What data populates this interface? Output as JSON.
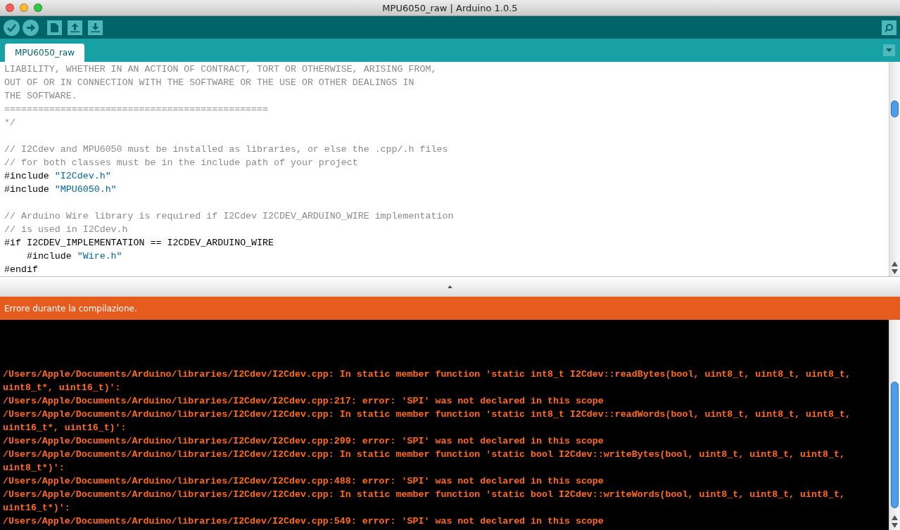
{
  "window": {
    "title": "MPU6050_raw | Arduino 1.0.5"
  },
  "tabs": [
    {
      "label": "MPU6050_raw",
      "selected": true
    }
  ],
  "editor": {
    "lines": [
      {
        "kind": "text",
        "segments": [
          {
            "kind": "comment",
            "text": "LIABILITY, WHETHER IN AN ACTION OF CONTRACT, TORT OR OTHERWISE, ARISING FROM,"
          }
        ]
      },
      {
        "kind": "text",
        "segments": [
          {
            "kind": "comment",
            "text": "OUT OF OR IN CONNECTION WITH THE SOFTWARE OR THE USE OR OTHER DEALINGS IN"
          }
        ]
      },
      {
        "kind": "text",
        "segments": [
          {
            "kind": "comment",
            "text": "THE SOFTWARE."
          }
        ]
      },
      {
        "kind": "text",
        "segments": [
          {
            "kind": "comment",
            "text": "==============================================="
          }
        ]
      },
      {
        "kind": "text",
        "segments": [
          {
            "kind": "comment",
            "text": "*/"
          }
        ]
      },
      {
        "kind": "blank"
      },
      {
        "kind": "text",
        "segments": [
          {
            "kind": "comment",
            "text": "// I2Cdev and MPU6050 must be installed as libraries, or else the .cpp/.h files"
          }
        ]
      },
      {
        "kind": "text",
        "segments": [
          {
            "kind": "comment",
            "text": "// for both classes must be in the include path of your project"
          }
        ]
      },
      {
        "kind": "text",
        "segments": [
          {
            "kind": "code",
            "text": "#include "
          },
          {
            "kind": "string",
            "text": "\"I2Cdev.h\""
          }
        ]
      },
      {
        "kind": "text",
        "segments": [
          {
            "kind": "code",
            "text": "#include "
          },
          {
            "kind": "string",
            "text": "\"MPU6050.h\""
          }
        ]
      },
      {
        "kind": "blank"
      },
      {
        "kind": "text",
        "segments": [
          {
            "kind": "comment",
            "text": "// Arduino Wire library is required if I2Cdev I2CDEV_ARDUINO_WIRE implementation"
          }
        ]
      },
      {
        "kind": "text",
        "segments": [
          {
            "kind": "comment",
            "text": "// is used in I2Cdev.h"
          }
        ]
      },
      {
        "kind": "text",
        "segments": [
          {
            "kind": "code",
            "text": "#if I2CDEV_IMPLEMENTATION == I2CDEV_ARDUINO_WIRE"
          }
        ]
      },
      {
        "kind": "text",
        "segments": [
          {
            "kind": "code",
            "text": "    #include "
          },
          {
            "kind": "string",
            "text": "\"Wire.h\""
          }
        ]
      },
      {
        "kind": "text",
        "segments": [
          {
            "kind": "code",
            "text": "#endif"
          }
        ]
      }
    ]
  },
  "status": {
    "message": "Errore durante la compilazione."
  },
  "console": {
    "lines": [
      "/Users/Apple/Documents/Arduino/libraries/I2Cdev/I2Cdev.cpp: In static member function 'static int8_t I2Cdev::readBytes(bool, uint8_t, uint8_t, uint8_t,",
      "uint8_t*, uint16_t)':",
      "/Users/Apple/Documents/Arduino/libraries/I2Cdev/I2Cdev.cpp:217: error: 'SPI' was not declared in this scope",
      "/Users/Apple/Documents/Arduino/libraries/I2Cdev/I2Cdev.cpp: In static member function 'static int8_t I2Cdev::readWords(bool, uint8_t, uint8_t, uint8_t,",
      "uint16_t*, uint16_t)':",
      "/Users/Apple/Documents/Arduino/libraries/I2Cdev/I2Cdev.cpp:299: error: 'SPI' was not declared in this scope",
      "/Users/Apple/Documents/Arduino/libraries/I2Cdev/I2Cdev.cpp: In static member function 'static bool I2Cdev::writeBytes(bool, uint8_t, uint8_t, uint8_t,",
      "uint8_t*)':",
      "/Users/Apple/Documents/Arduino/libraries/I2Cdev/I2Cdev.cpp:488: error: 'SPI' was not declared in this scope",
      "/Users/Apple/Documents/Arduino/libraries/I2Cdev/I2Cdev.cpp: In static member function 'static bool I2Cdev::writeWords(bool, uint8_t, uint8_t, uint8_t,",
      "uint16_t*)':",
      "/Users/Apple/Documents/Arduino/libraries/I2Cdev/I2Cdev.cpp:549: error: 'SPI' was not declared in this scope"
    ]
  }
}
